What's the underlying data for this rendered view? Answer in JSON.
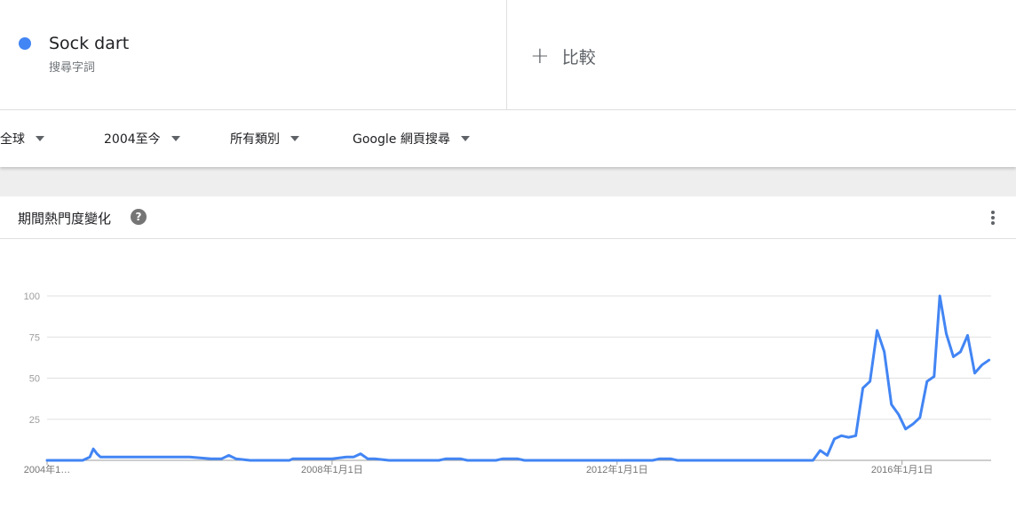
{
  "term": {
    "name": "Sock dart",
    "type": "搜尋字詞",
    "color": "#4285f4"
  },
  "compare": {
    "plus": "+",
    "label": "比較"
  },
  "filters": {
    "region": "全球",
    "time": "2004至今",
    "category": "所有類別",
    "search_type": "Google 網頁搜尋"
  },
  "chart_card": {
    "title": "期間熱門度變化",
    "help_icon": "help-icon",
    "more_icon": "more-vert-icon"
  },
  "chart_data": {
    "type": "line",
    "y_ticks": [
      "100",
      "75",
      "50",
      "25"
    ],
    "y_tick_values": [
      100,
      75,
      50,
      25
    ],
    "ylim": [
      0,
      100
    ],
    "x_ticks": [
      "2004年1…",
      "2008年1月1日",
      "2012年1月1日",
      "2016年1月1日"
    ],
    "x_tick_years": [
      2004,
      2008,
      2012,
      2016
    ],
    "grid": true,
    "series": [
      {
        "color": "#4285f4",
        "points": [
          [
            2004.0,
            0
          ],
          [
            2004.5,
            0
          ],
          [
            2004.6,
            2
          ],
          [
            2004.65,
            7
          ],
          [
            2004.7,
            4
          ],
          [
            2004.75,
            2
          ],
          [
            2005.0,
            2
          ],
          [
            2005.5,
            2
          ],
          [
            2006.0,
            2
          ],
          [
            2006.3,
            1
          ],
          [
            2006.45,
            1
          ],
          [
            2006.55,
            3
          ],
          [
            2006.65,
            1
          ],
          [
            2006.85,
            0
          ],
          [
            2007.0,
            0
          ],
          [
            2007.4,
            0
          ],
          [
            2007.45,
            1
          ],
          [
            2007.6,
            1
          ],
          [
            2008.0,
            1
          ],
          [
            2008.2,
            2
          ],
          [
            2008.3,
            2
          ],
          [
            2008.4,
            4
          ],
          [
            2008.5,
            1
          ],
          [
            2008.6,
            1
          ],
          [
            2008.8,
            0
          ],
          [
            2009.5,
            0
          ],
          [
            2009.6,
            1
          ],
          [
            2009.8,
            1
          ],
          [
            2009.9,
            0
          ],
          [
            2010.3,
            0
          ],
          [
            2010.4,
            1
          ],
          [
            2010.6,
            1
          ],
          [
            2010.7,
            0
          ],
          [
            2012.5,
            0
          ],
          [
            2012.6,
            1
          ],
          [
            2012.75,
            1
          ],
          [
            2012.85,
            0
          ],
          [
            2014.5,
            0
          ],
          [
            2014.75,
            0
          ],
          [
            2014.85,
            6
          ],
          [
            2014.95,
            3
          ],
          [
            2015.05,
            13
          ],
          [
            2015.15,
            15
          ],
          [
            2015.25,
            14
          ],
          [
            2015.35,
            15
          ],
          [
            2015.45,
            44
          ],
          [
            2015.55,
            48
          ],
          [
            2015.65,
            79
          ],
          [
            2015.75,
            66
          ],
          [
            2015.85,
            34
          ],
          [
            2015.95,
            28
          ],
          [
            2016.05,
            19
          ],
          [
            2016.15,
            22
          ],
          [
            2016.25,
            26
          ],
          [
            2016.35,
            48
          ],
          [
            2016.45,
            51
          ],
          [
            2016.53,
            100
          ],
          [
            2016.62,
            77
          ],
          [
            2016.72,
            63
          ],
          [
            2016.82,
            66
          ],
          [
            2016.92,
            76
          ],
          [
            2017.02,
            53
          ],
          [
            2017.12,
            58
          ],
          [
            2017.22,
            61
          ]
        ]
      }
    ]
  }
}
